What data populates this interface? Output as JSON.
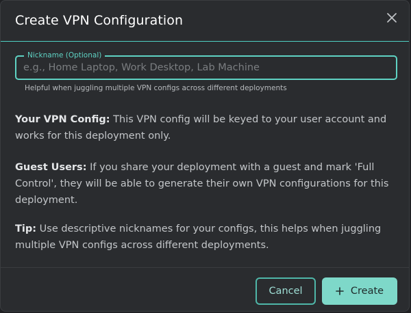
{
  "dialog": {
    "title": "Create VPN Configuration",
    "close_icon": "close-icon"
  },
  "nickname": {
    "label": "Nickname (Optional)",
    "value": "",
    "placeholder": "e.g., Home Laptop, Work Desktop, Lab Machine",
    "helper": "Helpful when juggling multiple VPN configs across different deployments"
  },
  "info": {
    "vpn_config_heading": "Your VPN Config:",
    "vpn_config_text": " This VPN config will be keyed to your user account and works for this deployment only.",
    "guest_users_heading": "Guest Users:",
    "guest_users_text": " If you share your deployment with a guest and mark 'Full Control', they will be able to generate their own VPN configurations for this deployment.",
    "tip_heading": "Tip:",
    "tip_text": " Use descriptive nicknames for your configs, this helps when juggling multiple VPN configs across different deployments."
  },
  "actions": {
    "cancel_label": "Cancel",
    "create_label": "Create",
    "create_icon": "plus-icon"
  },
  "colors": {
    "accent": "#5fd3c4",
    "primary_button": "#7ed8c9",
    "background": "#2a2c2f"
  }
}
